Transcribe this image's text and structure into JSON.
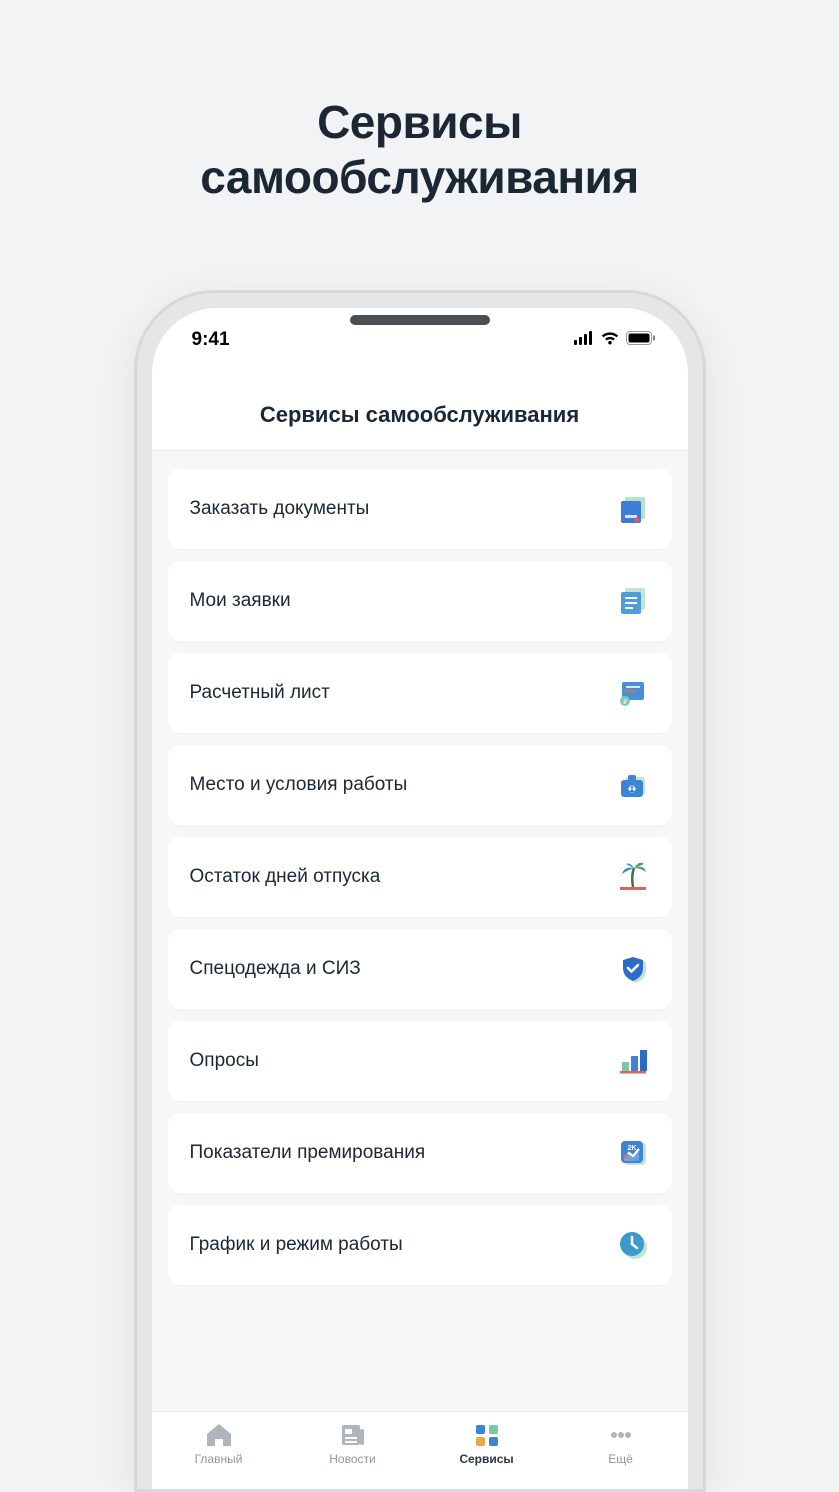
{
  "promo": {
    "heading_line1": "Сервисы",
    "heading_line2": "самообслуживания"
  },
  "statusbar": {
    "time": "9:41"
  },
  "header": {
    "title": "Сервисы самообслуживания"
  },
  "menu": [
    {
      "label": "Заказать документы",
      "icon": "document-order-icon"
    },
    {
      "label": "Мои заявки",
      "icon": "my-requests-icon"
    },
    {
      "label": "Расчетный лист",
      "icon": "payslip-icon"
    },
    {
      "label": "Место и условия работы",
      "icon": "workplace-icon"
    },
    {
      "label": "Остаток дней отпуска",
      "icon": "vacation-balance-icon"
    },
    {
      "label": "Спецодежда и СИЗ",
      "icon": "ppe-icon"
    },
    {
      "label": "Опросы",
      "icon": "surveys-icon"
    },
    {
      "label": "Показатели премирования",
      "icon": "bonus-metrics-icon"
    },
    {
      "label": "График и режим работы",
      "icon": "schedule-icon"
    }
  ],
  "tabs": [
    {
      "label": "Главный",
      "icon": "home-icon",
      "active": false
    },
    {
      "label": "Новости",
      "icon": "news-icon",
      "active": false
    },
    {
      "label": "Сервисы",
      "icon": "services-icon",
      "active": true
    },
    {
      "label": "Ещё",
      "icon": "more-icon",
      "active": false
    }
  ]
}
